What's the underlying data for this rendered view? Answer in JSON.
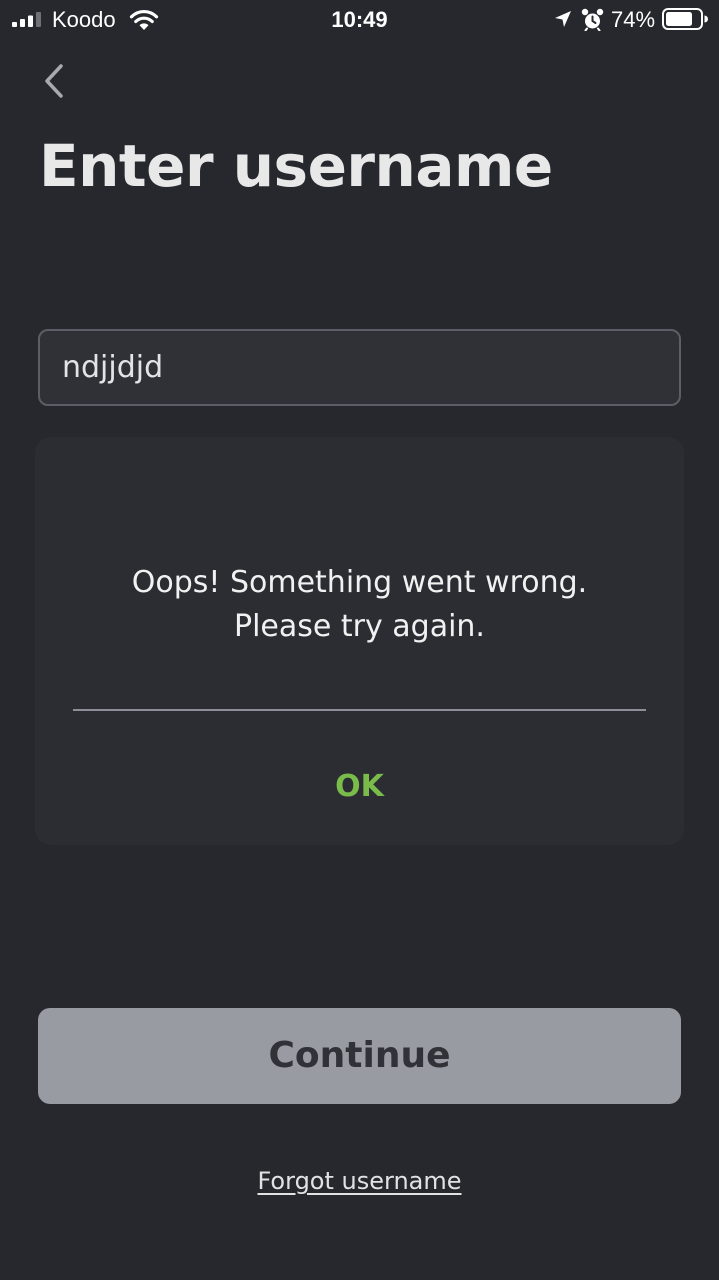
{
  "status_bar": {
    "carrier": "Koodo",
    "time": "10:49",
    "battery_percent": "74%",
    "icons": [
      "signal-icon",
      "wifi-icon",
      "location-icon",
      "alarm-icon",
      "battery-icon"
    ]
  },
  "header": {
    "back_icon": "chevron-left-icon",
    "title": "Enter username"
  },
  "username_input": {
    "value": "ndjjdjd"
  },
  "dialog": {
    "message": "Oops! Something went wrong.\nPlease try again.",
    "ok_label": "OK"
  },
  "continue_button": {
    "label": "Continue"
  },
  "forgot_link": {
    "label": "Forgot username"
  },
  "colors": {
    "background": "#26282d",
    "dialog_background": "#2b2d32",
    "accent_green": "#79bc4a",
    "continue_disabled": "#989ba2"
  }
}
